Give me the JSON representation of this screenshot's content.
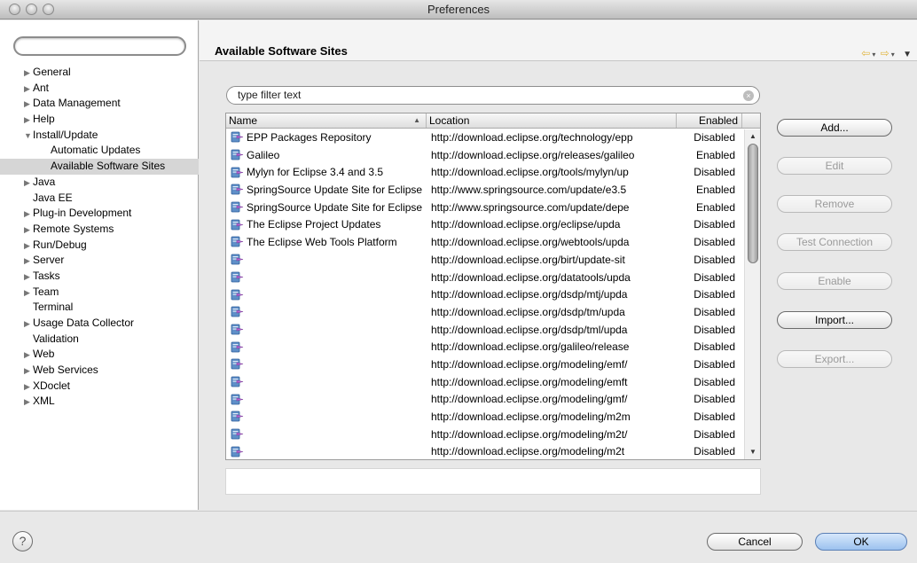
{
  "window": {
    "title": "Preferences"
  },
  "sidebar": {
    "search_placeholder": "",
    "items": [
      {
        "label": "General",
        "level": 0,
        "arrow": "▶"
      },
      {
        "label": "Ant",
        "level": 0,
        "arrow": "▶"
      },
      {
        "label": "Data Management",
        "level": 0,
        "arrow": "▶"
      },
      {
        "label": "Help",
        "level": 0,
        "arrow": "▶"
      },
      {
        "label": "Install/Update",
        "level": 0,
        "arrow": "▼"
      },
      {
        "label": "Automatic Updates",
        "level": 1,
        "arrow": ""
      },
      {
        "label": "Available Software Sites",
        "level": 1,
        "arrow": "",
        "selected": true
      },
      {
        "label": "Java",
        "level": 0,
        "arrow": "▶"
      },
      {
        "label": "Java EE",
        "level": 0,
        "arrow": ""
      },
      {
        "label": "Plug-in Development",
        "level": 0,
        "arrow": "▶"
      },
      {
        "label": "Remote Systems",
        "level": 0,
        "arrow": "▶"
      },
      {
        "label": "Run/Debug",
        "level": 0,
        "arrow": "▶"
      },
      {
        "label": "Server",
        "level": 0,
        "arrow": "▶"
      },
      {
        "label": "Tasks",
        "level": 0,
        "arrow": "▶"
      },
      {
        "label": "Team",
        "level": 0,
        "arrow": "▶"
      },
      {
        "label": "Terminal",
        "level": 0,
        "arrow": ""
      },
      {
        "label": "Usage Data Collector",
        "level": 0,
        "arrow": "▶"
      },
      {
        "label": "Validation",
        "level": 0,
        "arrow": ""
      },
      {
        "label": "Web",
        "level": 0,
        "arrow": "▶"
      },
      {
        "label": "Web Services",
        "level": 0,
        "arrow": "▶"
      },
      {
        "label": "XDoclet",
        "level": 0,
        "arrow": "▶"
      },
      {
        "label": "XML",
        "level": 0,
        "arrow": "▶"
      }
    ]
  },
  "page": {
    "title": "Available Software Sites",
    "filter_text": "type filter text",
    "columns": {
      "name": "Name",
      "location": "Location",
      "enabled": "Enabled"
    },
    "rows": [
      {
        "name": "EPP Packages Repository",
        "location": "http://download.eclipse.org/technology/epp",
        "enabled": "Disabled"
      },
      {
        "name": "Galileo",
        "location": "http://download.eclipse.org/releases/galileo",
        "enabled": "Enabled"
      },
      {
        "name": "Mylyn for Eclipse 3.4 and 3.5",
        "location": "http://download.eclipse.org/tools/mylyn/up",
        "enabled": "Disabled"
      },
      {
        "name": "SpringSource Update Site for Eclipse",
        "location": "http://www.springsource.com/update/e3.5",
        "enabled": "Enabled"
      },
      {
        "name": "SpringSource Update Site for Eclipse",
        "location": "http://www.springsource.com/update/depe",
        "enabled": "Enabled"
      },
      {
        "name": "The Eclipse Project Updates",
        "location": "http://download.eclipse.org/eclipse/upda",
        "enabled": "Disabled"
      },
      {
        "name": "The Eclipse Web Tools Platform",
        "location": "http://download.eclipse.org/webtools/upda",
        "enabled": "Disabled"
      },
      {
        "name": "",
        "location": "http://download.eclipse.org/birt/update-sit",
        "enabled": "Disabled"
      },
      {
        "name": "",
        "location": "http://download.eclipse.org/datatools/upda",
        "enabled": "Disabled"
      },
      {
        "name": "",
        "location": "http://download.eclipse.org/dsdp/mtj/upda",
        "enabled": "Disabled"
      },
      {
        "name": "",
        "location": "http://download.eclipse.org/dsdp/tm/upda",
        "enabled": "Disabled"
      },
      {
        "name": "",
        "location": "http://download.eclipse.org/dsdp/tml/upda",
        "enabled": "Disabled"
      },
      {
        "name": "",
        "location": "http://download.eclipse.org/galileo/release",
        "enabled": "Disabled"
      },
      {
        "name": "",
        "location": "http://download.eclipse.org/modeling/emf/",
        "enabled": "Disabled"
      },
      {
        "name": "",
        "location": "http://download.eclipse.org/modeling/emft",
        "enabled": "Disabled"
      },
      {
        "name": "",
        "location": "http://download.eclipse.org/modeling/gmf/",
        "enabled": "Disabled"
      },
      {
        "name": "",
        "location": "http://download.eclipse.org/modeling/m2m",
        "enabled": "Disabled"
      },
      {
        "name": "",
        "location": "http://download.eclipse.org/modeling/m2t/",
        "enabled": "Disabled"
      },
      {
        "name": "",
        "location": "http://download.eclipse.org/modeling/m2t",
        "enabled": "Disabled"
      }
    ],
    "buttons": {
      "add": "Add...",
      "edit": "Edit",
      "remove": "Remove",
      "test_connection": "Test Connection",
      "enable": "Enable",
      "import": "Import...",
      "export": "Export..."
    }
  },
  "footer": {
    "help": "?",
    "cancel": "Cancel",
    "ok": "OK"
  },
  "colors": {
    "accent": "#9cc2ef",
    "nav_arrow": "#e0b640",
    "selection": "#d6d6d6"
  }
}
